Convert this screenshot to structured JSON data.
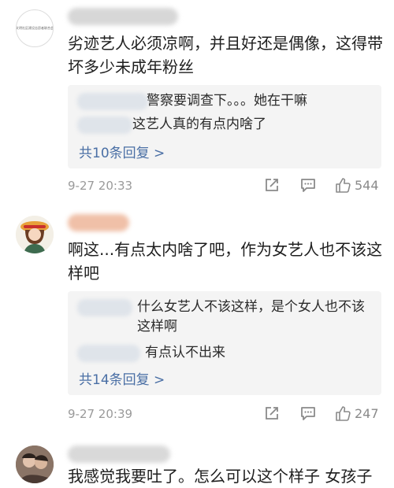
{
  "comments": [
    {
      "text": "劣迹艺人必须凉啊，并且好还是偶像，这得带坏多少未成年粉丝",
      "avatar_text": "文明社区建设志愿者联合会",
      "replies": [
        "警察要调查下。。。她在干嘛",
        "这艺人真的有点内啥了"
      ],
      "more": "共10条回复 >",
      "time": "9-27 20:33",
      "likes": "544"
    },
    {
      "text": "啊这...有点太内啥了吧，作为女艺人也不该这样吧",
      "replies": [
        "什么女艺人不该这样，是个女人也不该这样啊",
        "有点认不出来"
      ],
      "more": "共14条回复 >",
      "time": "9-27 20:39",
      "likes": "247"
    },
    {
      "text": "我感觉我要吐了。怎么可以这个样子 女孩子"
    }
  ],
  "icons": [
    "share-icon",
    "reply-icon",
    "like-icon"
  ],
  "colors": {
    "link": "#4a6fa5",
    "meta": "#9a9a9a",
    "reply_bg": "#f4f4f4"
  }
}
